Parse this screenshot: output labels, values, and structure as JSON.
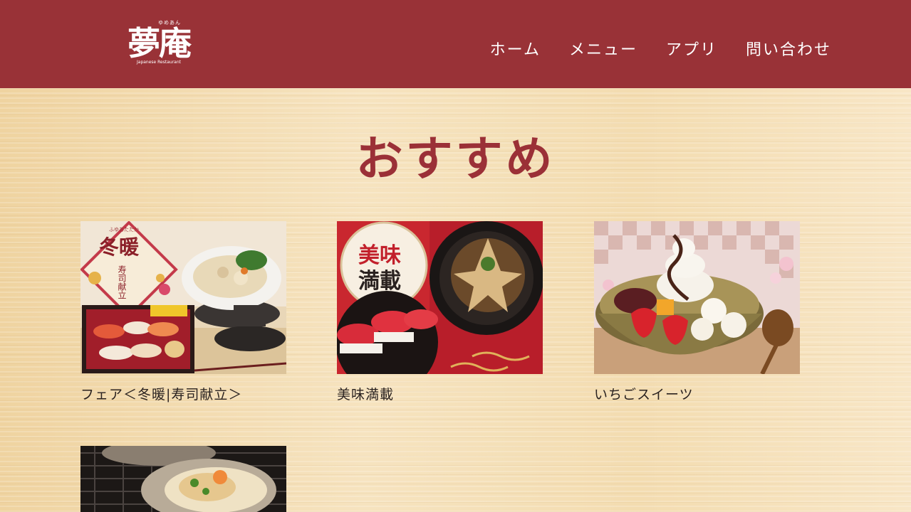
{
  "header": {
    "logo": {
      "ruby": "ゆめあん",
      "name": "夢庵",
      "sub": "Japanese Restaurant"
    },
    "nav": [
      "ホーム",
      "メニュー",
      "アプリ",
      "問い合わせ"
    ]
  },
  "main": {
    "title": "おすすめ",
    "cards": [
      {
        "caption": "フェア＜冬暖|寿司献立＞",
        "badge_ruby": "ふゆあたたか",
        "badge_big": "冬暖",
        "badge_small": "寿司献立"
      },
      {
        "caption": "美味満載",
        "badge_line1": "美味",
        "badge_line2": "満載"
      },
      {
        "caption": "いちごスイーツ"
      },
      {
        "caption": ""
      }
    ]
  },
  "colors": {
    "header": "#993237",
    "title": "#9b3037",
    "caption": "#2a2220"
  }
}
